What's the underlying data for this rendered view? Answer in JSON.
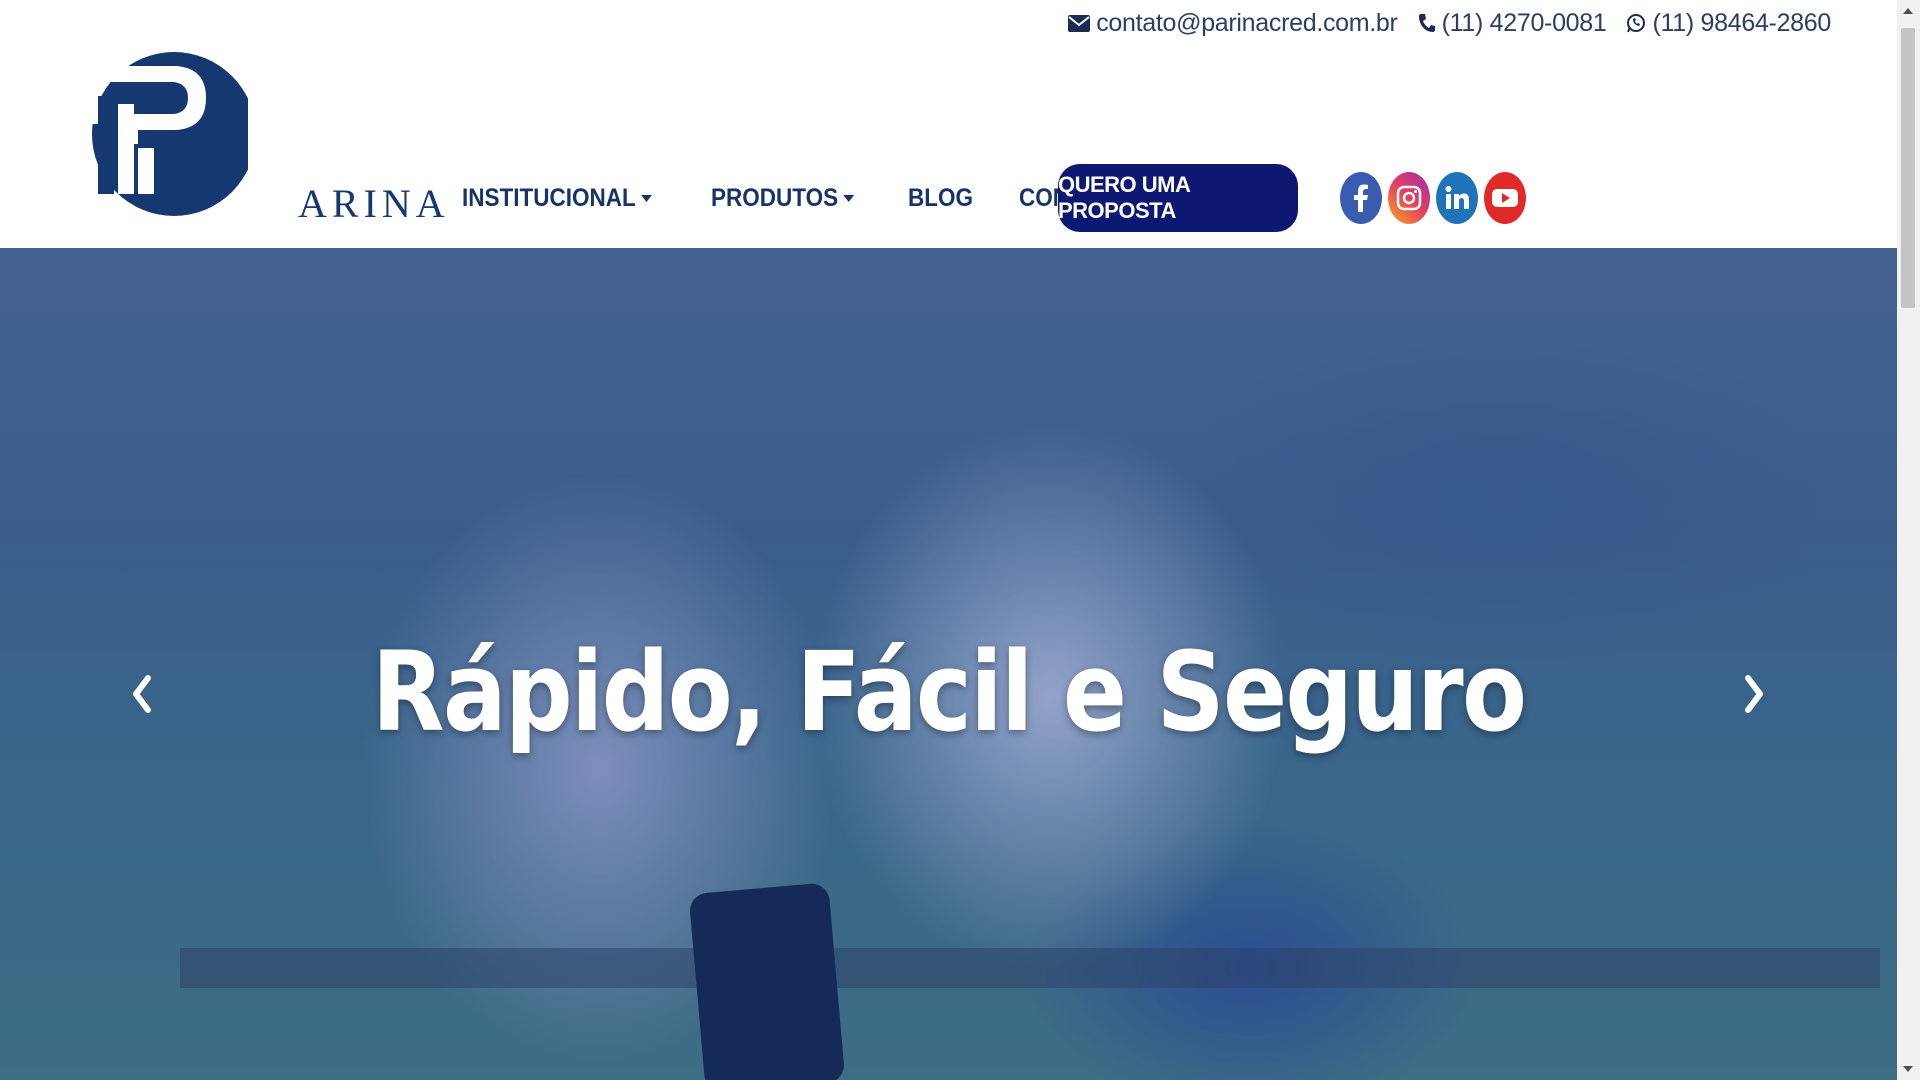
{
  "topbar": {
    "email": "contato@parinacred.com.br",
    "phone": "(11) 4270-0081",
    "whatsapp": "(11) 98464-2860"
  },
  "logo": {
    "word": "ARINA"
  },
  "nav": {
    "items": [
      {
        "label": "INSTITUCIONAL",
        "dropdown": true
      },
      {
        "label": "PRODUTOS",
        "dropdown": true
      },
      {
        "label": "BLOG",
        "dropdown": false
      },
      {
        "label": "CONTATO",
        "dropdown": false
      }
    ],
    "cta_label": "QUERO UMA PROPOSTA"
  },
  "socials": [
    {
      "icon": "facebook-icon",
      "color": "#3b5bb0"
    },
    {
      "icon": "instagram-icon",
      "color": "#e4405f"
    },
    {
      "icon": "linkedin-icon",
      "color": "#1f74b9"
    },
    {
      "icon": "youtube-icon",
      "color": "#e02a2a"
    }
  ],
  "hero": {
    "title": "Rápido, Fácil e Seguro",
    "prev_icon": "chevron-left-icon",
    "next_icon": "chevron-right-icon"
  },
  "colors": {
    "brand_navy": "#14386f",
    "cta_bg": "#0d1872",
    "nav_text": "#16336a"
  }
}
